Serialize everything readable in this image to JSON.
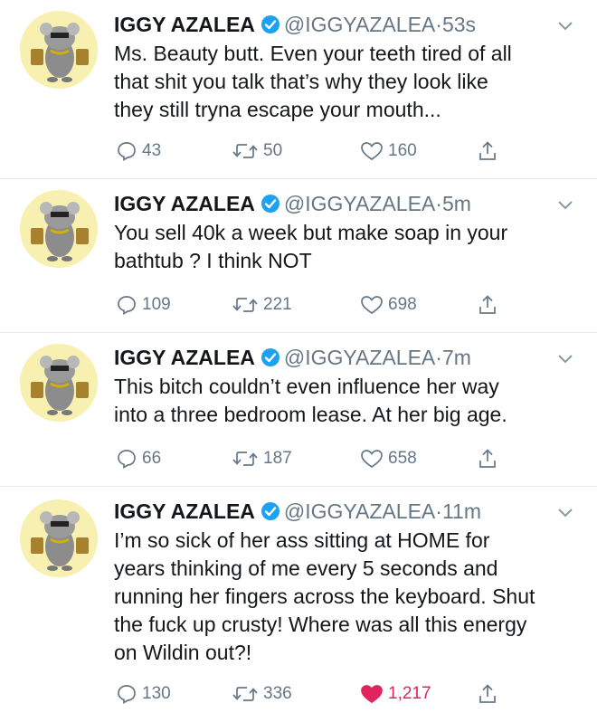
{
  "colors": {
    "text": "#14171a",
    "muted": "#657786",
    "verified": "#1da1f2",
    "like": "#e0245e",
    "divider": "#e6ecf0"
  },
  "icons": [
    "verified-badge-icon",
    "chevron-down-icon",
    "reply-icon",
    "retweet-icon",
    "like-icon",
    "share-icon"
  ],
  "tweets": [
    {
      "name": "IGGY AZALEA",
      "handle": "@IGGYAZALEA",
      "dot": "·",
      "time": "53s",
      "lines": [
        "Ms. Beauty butt. Even your teeth tired of all",
        "that shit you talk that’s why they look like",
        "they still tryna escape your mouth..."
      ],
      "replies": "43",
      "retweets": "50",
      "likes": "160",
      "liked": false
    },
    {
      "name": "IGGY AZALEA",
      "handle": "@IGGYAZALEA",
      "dot": "·",
      "time": "5m",
      "lines": [
        "You sell 40k a week but make soap in your",
        "bathtub ? I think NOT"
      ],
      "replies": "109",
      "retweets": "221",
      "likes": "698",
      "liked": false
    },
    {
      "name": "IGGY AZALEA",
      "handle": "@IGGYAZALEA",
      "dot": "·",
      "time": "7m",
      "lines": [
        "This bitch couldn’t even influence her way",
        "into a three bedroom lease. At her big age."
      ],
      "replies": "66",
      "retweets": "187",
      "likes": "658",
      "liked": false
    },
    {
      "name": "IGGY AZALEA",
      "handle": "@IGGYAZALEA",
      "dot": "·",
      "time": "11m",
      "lines": [
        "I’m so sick of her ass sitting at HOME for",
        "years thinking of me every 5 seconds and",
        "running her fingers across the keyboard. Shut",
        "the fuck up crusty! Where was all this energy",
        "on Wildin out?!"
      ],
      "replies": "130",
      "retweets": "336",
      "likes": "1,217",
      "liked": true
    }
  ]
}
